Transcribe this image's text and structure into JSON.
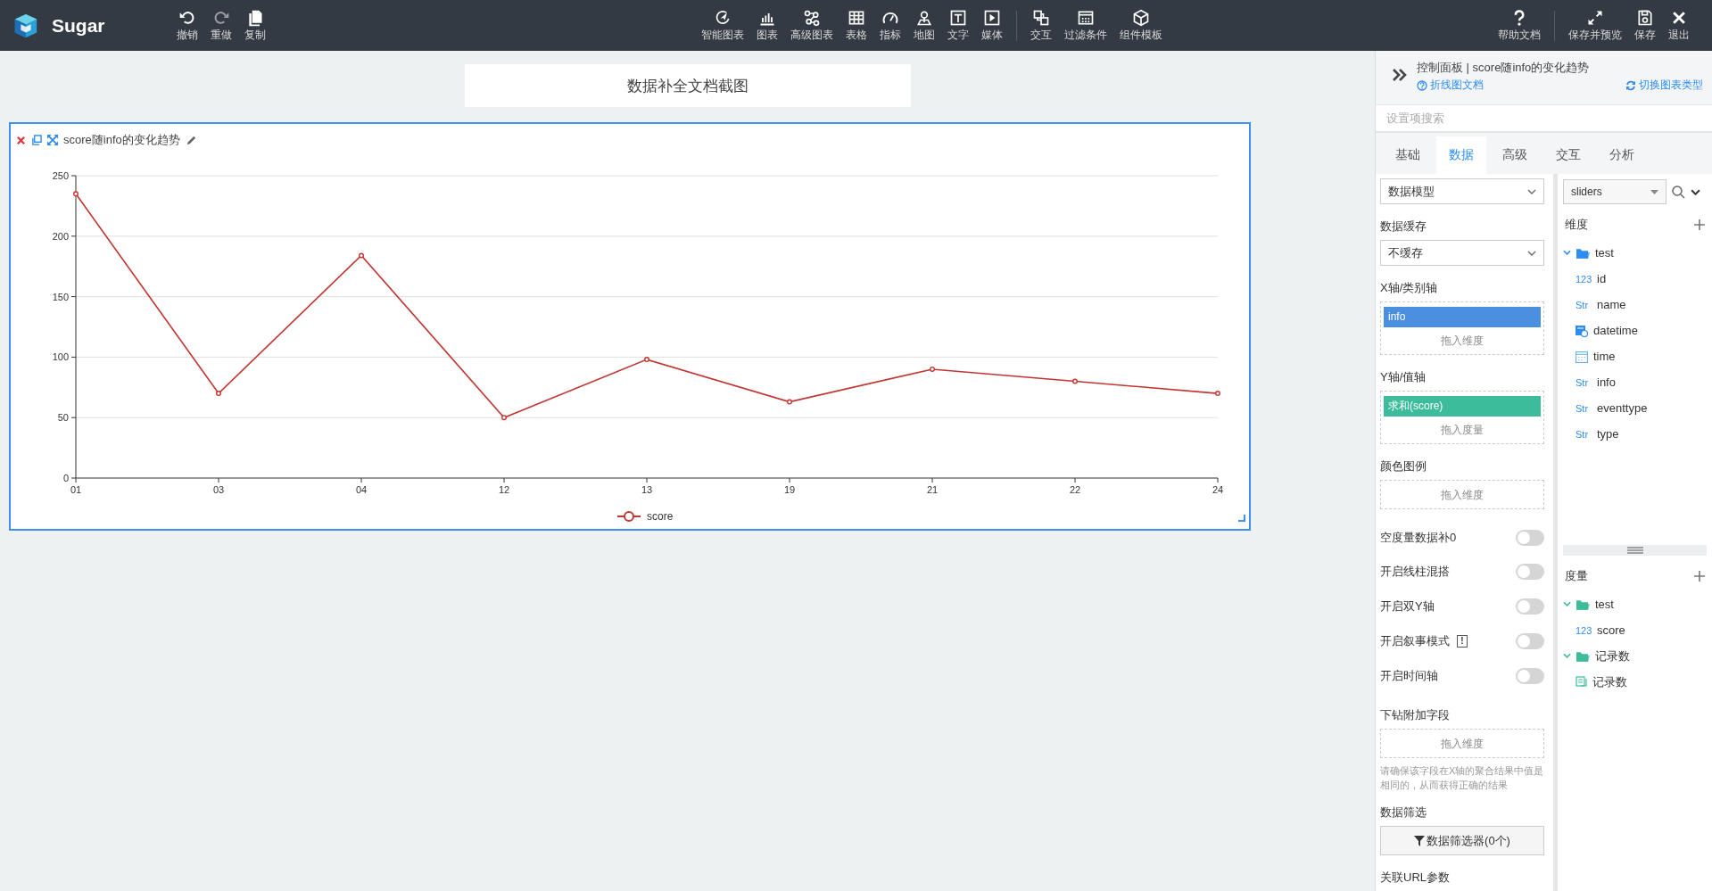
{
  "app": {
    "name": "Sugar"
  },
  "toolbar": {
    "left": [
      {
        "kind": "undo",
        "label": "撤销",
        "disabled": false
      },
      {
        "kind": "redo",
        "label": "重做",
        "disabled": true
      },
      {
        "kind": "copy",
        "label": "复制",
        "disabled": false
      }
    ],
    "center": [
      [
        {
          "kind": "smart",
          "label": "智能图表"
        },
        {
          "kind": "bar",
          "label": "图表"
        },
        {
          "kind": "graph",
          "label": "高级图表"
        },
        {
          "kind": "table",
          "label": "表格"
        },
        {
          "kind": "gauge",
          "label": "指标"
        },
        {
          "kind": "map",
          "label": "地图"
        },
        {
          "kind": "text",
          "label": "文字"
        },
        {
          "kind": "media",
          "label": "媒体"
        }
      ],
      [
        {
          "kind": "interact",
          "label": "交互"
        },
        {
          "kind": "filter",
          "label": "过滤条件"
        },
        {
          "kind": "template",
          "label": "组件模板"
        }
      ]
    ],
    "right": [
      [
        {
          "kind": "help",
          "label": "帮助文档"
        }
      ],
      [
        {
          "kind": "expand",
          "label": "保存并预览"
        },
        {
          "kind": "save",
          "label": "保存"
        },
        {
          "kind": "exit",
          "label": "退出"
        }
      ]
    ]
  },
  "canvas": {
    "page_title": "数据补全文档截图",
    "chart_card": {
      "title": "score随info的变化趋势",
      "chart_data": {
        "type": "line",
        "categories": [
          "01",
          "03",
          "04",
          "12",
          "13",
          "19",
          "21",
          "22",
          "24"
        ],
        "series": [
          {
            "name": "score",
            "color": "#c23531",
            "marker": "circle",
            "values": [
              235,
              70,
              184,
              50,
              98,
              63,
              90,
              80,
              70
            ]
          }
        ],
        "grid": true,
        "ylim": [
          0,
          250
        ],
        "yticks": [
          0,
          50,
          100,
          150,
          200,
          250
        ]
      }
    }
  },
  "panel": {
    "title": "控制面板 | score随info的变化趋势",
    "doc_link": "折线图文档",
    "switch_link": "切换图表类型",
    "search": {
      "placeholder": "设置项搜索"
    },
    "tabs": [
      {
        "label": "基础",
        "selected": false
      },
      {
        "label": "数据",
        "selected": true
      },
      {
        "label": "高级",
        "selected": false
      },
      {
        "label": "交互",
        "selected": false
      },
      {
        "label": "分析",
        "selected": false
      }
    ],
    "settings": [
      {
        "kind": "select",
        "value": "数据模型"
      },
      {
        "kind": "select",
        "label": "数据缓存",
        "value": "不缓存"
      },
      {
        "kind": "drop",
        "label": "X轴/类别轴",
        "chips": [
          {
            "kind": "dimension",
            "text": "info"
          }
        ],
        "hint": "拖入维度"
      },
      {
        "kind": "drop",
        "label": "Y轴/值轴",
        "chips": [
          {
            "kind": "measure",
            "text": "求和(score)"
          }
        ],
        "hint": "拖入度量"
      },
      {
        "kind": "drop",
        "label": "颜色图例",
        "hint": "拖入维度"
      },
      {
        "kind": "switch",
        "label": "空度量数据补0",
        "on": false
      },
      {
        "kind": "switch",
        "label": "开启线柱混搭",
        "on": false
      },
      {
        "kind": "switch",
        "label": "开启双Y轴",
        "on": false
      },
      {
        "kind": "switch",
        "label": "开启叙事模式",
        "on": false,
        "badge": "!"
      },
      {
        "kind": "switch",
        "label": "开启时间轴",
        "on": false
      },
      {
        "kind": "drop",
        "label": "下钻附加字段",
        "hint": "拖入维度",
        "note": "请确保该字段在X轴的聚合结果中值是相同的，从而获得正确的结果"
      },
      {
        "kind": "button",
        "label": "数据筛选",
        "button": "数据筛选器(0个)"
      },
      {
        "kind": "heading",
        "label": "关联URL参数"
      }
    ],
    "dataset": "sliders",
    "dimensions": {
      "title": "维度",
      "tree": [
        {
          "kind": "folder",
          "label": "test",
          "expanded": true,
          "children": [
            {
              "kind": "field",
              "type_label": "123",
              "label": "id"
            },
            {
              "kind": "field",
              "type_label": "Str",
              "label": "name"
            },
            {
              "kind": "datetime",
              "label": "datetime"
            },
            {
              "kind": "time",
              "label": "time"
            },
            {
              "kind": "field",
              "type_label": "Str",
              "label": "info"
            },
            {
              "kind": "field",
              "type_label": "Str",
              "label": "eventtype"
            },
            {
              "kind": "field",
              "type_label": "Str",
              "label": "type"
            }
          ]
        }
      ]
    },
    "measures": {
      "title": "度量",
      "tree": [
        {
          "kind": "folder",
          "label": "test",
          "expanded": true,
          "children": [
            {
              "kind": "field",
              "type_label": "123",
              "label": "score"
            }
          ]
        },
        {
          "kind": "folder",
          "label": "记录数",
          "expanded": true,
          "children": [
            {
              "kind": "count",
              "label": "记录数"
            }
          ]
        }
      ]
    }
  }
}
